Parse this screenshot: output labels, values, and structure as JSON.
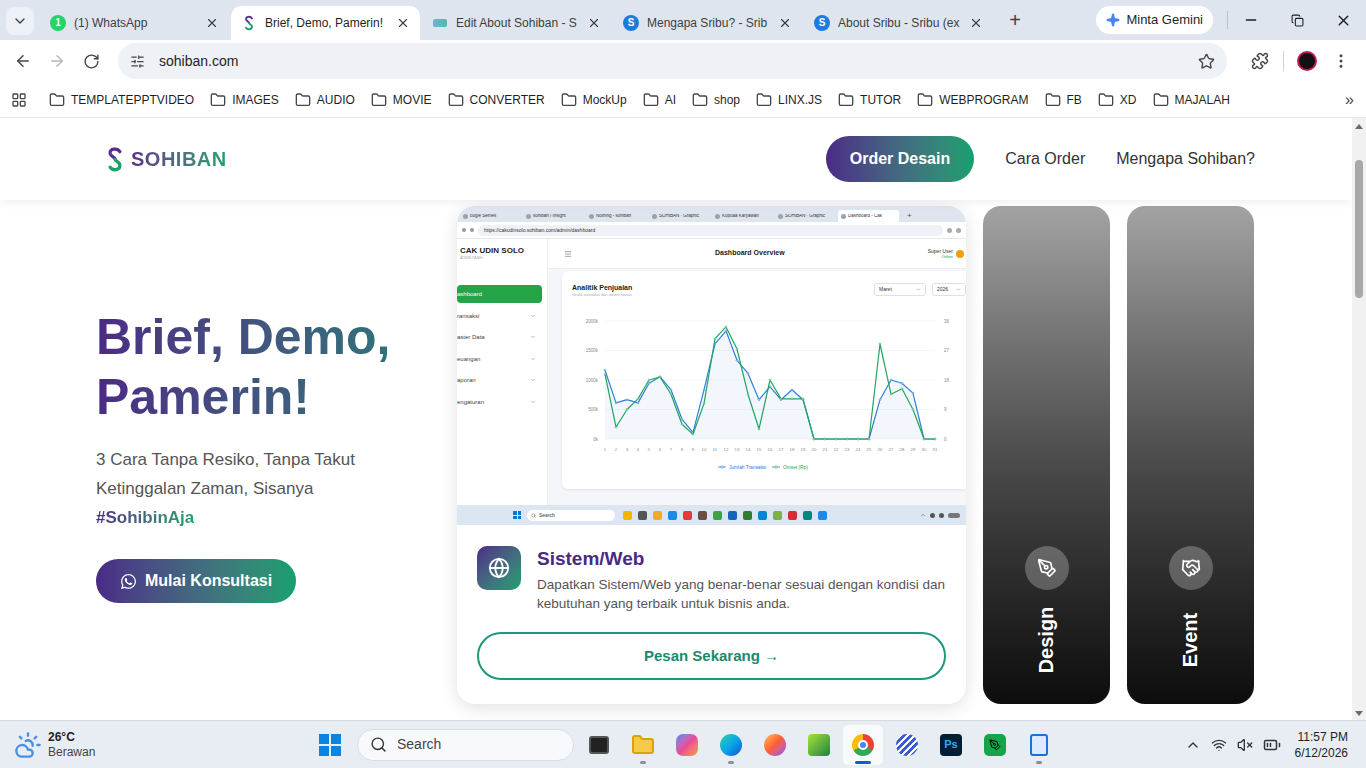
{
  "browser": {
    "tabs": [
      {
        "title": "(1) WhatsApp",
        "kind": "whatsapp",
        "badge": "1",
        "selected": false
      },
      {
        "title": "Brief, Demo, Pamerin!",
        "kind": "sohiban",
        "badge": "",
        "selected": true
      },
      {
        "title": "Edit About Sohiban - S",
        "kind": "editor",
        "badge": "",
        "selected": false
      },
      {
        "title": "Mengapa Sribu? - Srib",
        "kind": "sribu",
        "badge": "S",
        "selected": false
      },
      {
        "title": "About Sribu - Sribu (ex",
        "kind": "sribu",
        "badge": "S",
        "selected": false
      }
    ],
    "new_tab": "+",
    "assistant": "Minta Gemini",
    "back_enabled": true,
    "forward_enabled": false,
    "address": "sohiban.com",
    "bookmarks": [
      "TEMPLATEPPTVIDEO",
      "IMAGES",
      "AUDIO",
      "MOVIE",
      "CONVERTER",
      "MockUp",
      "AI",
      "shop",
      "LINX.JS",
      "TUTOR",
      "WEBPROGRAM",
      "FB",
      "XD",
      "MAJALAH"
    ],
    "bookmarks_more": "»"
  },
  "page": {
    "logo": "SOHIBAN",
    "nav": [
      {
        "label": "Order Desain",
        "kind": "button"
      },
      {
        "label": "Cara Order",
        "kind": "link"
      },
      {
        "label": "Mengapa Sohiban?",
        "kind": "link"
      }
    ],
    "hero": {
      "title": "Brief, Demo, Pamerin!",
      "subtitle": "3 Cara Tanpa Resiko, Tanpa Takut Ketinggalan Zaman, Sisanya",
      "hashtag": "#SohibinAja",
      "cta": "Mulai Konsultasi"
    },
    "services": [
      {
        "title": "Sistem/Web",
        "kind": "web",
        "expanded": true,
        "description": "Dapatkan Sistem/Web yang benar-benar sesuai dengan kondisi dan kebutuhan yang terbaik untuk bisnis anda.",
        "button": "Pesan Sekarang →"
      },
      {
        "title": "Design",
        "kind": "design",
        "expanded": false,
        "description": "",
        "button": ""
      },
      {
        "title": "Event",
        "kind": "event",
        "expanded": false,
        "description": "",
        "button": ""
      }
    ]
  },
  "preview": {
    "tabs": [
      {
        "label": "oogle Semes",
        "selected": false
      },
      {
        "label": "sohiban / Insight",
        "selected": false
      },
      {
        "label": "Nothing - sohiban",
        "selected": false
      },
      {
        "label": "SOHIBAN · Graphic",
        "selected": false
      },
      {
        "label": "Kopuaa Karyawan",
        "selected": false
      },
      {
        "label": "SOHIBAN · Graphic",
        "selected": false
      },
      {
        "label": "Dashboard - Cak",
        "selected": true
      }
    ],
    "new_tab": "+",
    "url": "https://cakudinsolo.sohiban.com/admin/dashboard",
    "brand": "CAK UDIN SOLO",
    "brand_sub": "ADMIN PANEL",
    "menu": [
      {
        "label": "ashboard",
        "selected": true,
        "expandable": false
      },
      {
        "label": "ransaksi",
        "selected": false,
        "expandable": true
      },
      {
        "label": "aster Data",
        "selected": false,
        "expandable": true
      },
      {
        "label": "euangan",
        "selected": false,
        "expandable": true
      },
      {
        "label": "aporan",
        "selected": false,
        "expandable": true
      },
      {
        "label": "engaturan",
        "selected": false,
        "expandable": true
      }
    ],
    "header": "Dashboard Overview",
    "user": "Super User",
    "user_status": "Online",
    "chart": {
      "title": "Analitik Penjualan",
      "subtitle": "Grafik transaksi dan omzet harian",
      "month": "Maret",
      "year": "2026",
      "left_ticks": [
        "2000k",
        "1500k",
        "1000k",
        "500k",
        "0k"
      ],
      "right_ticks": [
        "36",
        "27",
        "18",
        "9",
        "0"
      ],
      "x_labels": [
        "1",
        "2",
        "3",
        "4",
        "5",
        "6",
        "7",
        "8",
        "9",
        "10",
        "11",
        "12",
        "13",
        "14",
        "15",
        "16",
        "17",
        "18",
        "19",
        "20",
        "21",
        "22",
        "23",
        "24",
        "25",
        "26",
        "27",
        "28",
        "29",
        "30",
        "31"
      ],
      "series": [
        {
          "name": "Jumlah Transaksi",
          "axis": "right",
          "color": "#2f7fd6",
          "values": [
            21,
            11,
            12,
            11,
            17,
            19,
            15,
            6,
            2,
            15,
            29,
            33,
            24,
            20,
            12,
            16,
            12,
            15,
            12,
            0,
            0,
            0,
            0,
            0,
            0,
            12,
            18,
            17,
            14,
            0,
            0
          ]
        },
        {
          "name": "Omset (Rp)",
          "axis": "left",
          "color": "#22a45d",
          "values": [
            1100,
            200,
            500,
            680,
            1000,
            1050,
            760,
            250,
            80,
            600,
            1700,
            1900,
            1525,
            760,
            170,
            1000,
            680,
            680,
            680,
            0,
            0,
            0,
            0,
            0,
            0,
            1610,
            760,
            850,
            500,
            0,
            0
          ]
        }
      ]
    },
    "taskbar_search": "Search"
  },
  "taskbar": {
    "weather": {
      "temp": "26°C",
      "condition": "Berawan"
    },
    "search": "Search",
    "apps": [
      {
        "kind": "terminal",
        "label": "",
        "running": false,
        "selected": false
      },
      {
        "kind": "files",
        "label": "",
        "running": true,
        "selected": false
      },
      {
        "kind": "copilot",
        "label": "",
        "running": false,
        "selected": false
      },
      {
        "kind": "edge",
        "label": "",
        "running": true,
        "selected": false
      },
      {
        "kind": "firefox",
        "label": "",
        "running": false,
        "selected": false
      },
      {
        "kind": "greenapp",
        "label": "",
        "running": false,
        "selected": false
      },
      {
        "kind": "chrome",
        "label": "",
        "running": true,
        "selected": true
      },
      {
        "kind": "stripes",
        "label": "",
        "running": false,
        "selected": false
      },
      {
        "kind": "photoshop",
        "label": "Ps",
        "running": false,
        "selected": false
      },
      {
        "kind": "pen",
        "label": "",
        "running": false,
        "selected": false
      },
      {
        "kind": "notepad",
        "label": "",
        "running": true,
        "selected": false
      }
    ],
    "time": "11:57 PM",
    "date": "6/12/2026"
  }
}
